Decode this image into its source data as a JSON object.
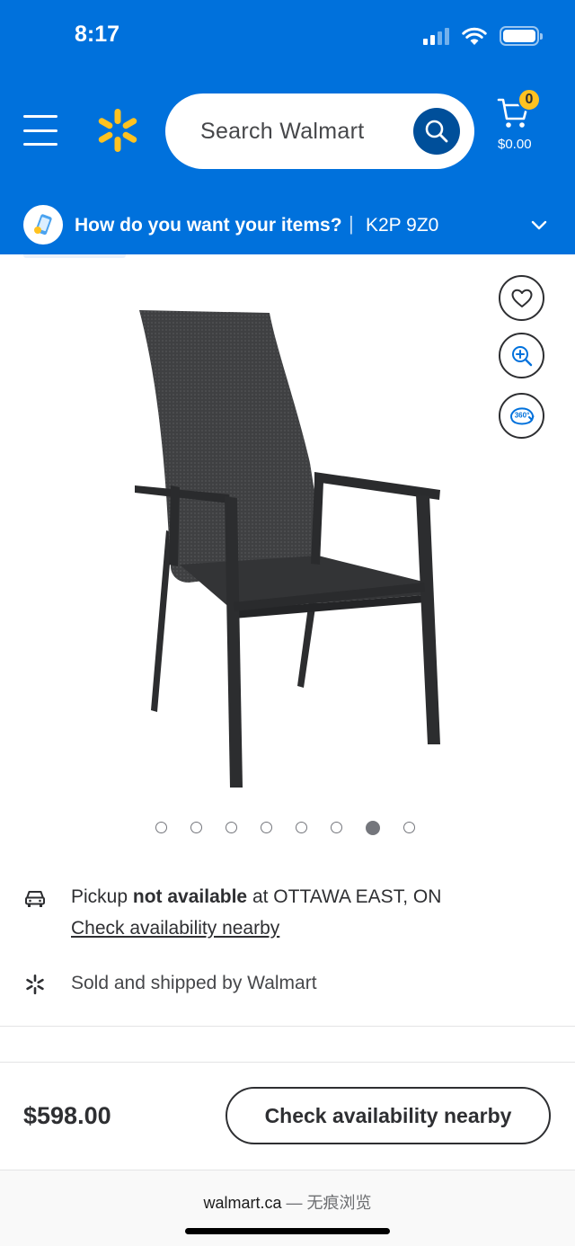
{
  "status_bar": {
    "time": "8:17"
  },
  "header": {
    "search_placeholder": "Search Walmart",
    "cart_count": "0",
    "cart_total": "$0.00",
    "brand_color": "#0071dc",
    "spark_color": "#ffc220"
  },
  "delivery": {
    "question": "How do you want your items?",
    "separator": "|",
    "postal_code": "K2P 9Z0"
  },
  "gallery": {
    "image_alt": "Black sling patio dining chair",
    "side_buttons": [
      "heart-icon",
      "zoom-in-icon",
      "360-view-icon"
    ],
    "view_360_label": "360°",
    "dot_count": 8,
    "active_dot_index": 6
  },
  "fulfillment": {
    "pickup_prefix": "Pickup",
    "pickup_status": "not available",
    "pickup_location": "at OTTAWA EAST, ON",
    "check_link": "Check availability nearby",
    "sold_by": "Sold and shipped by Walmart"
  },
  "bottom_bar": {
    "price": "$598.00",
    "cta_label": "Check availability nearby"
  },
  "browser": {
    "domain": "walmart.ca",
    "mode": "— 无痕浏览"
  }
}
